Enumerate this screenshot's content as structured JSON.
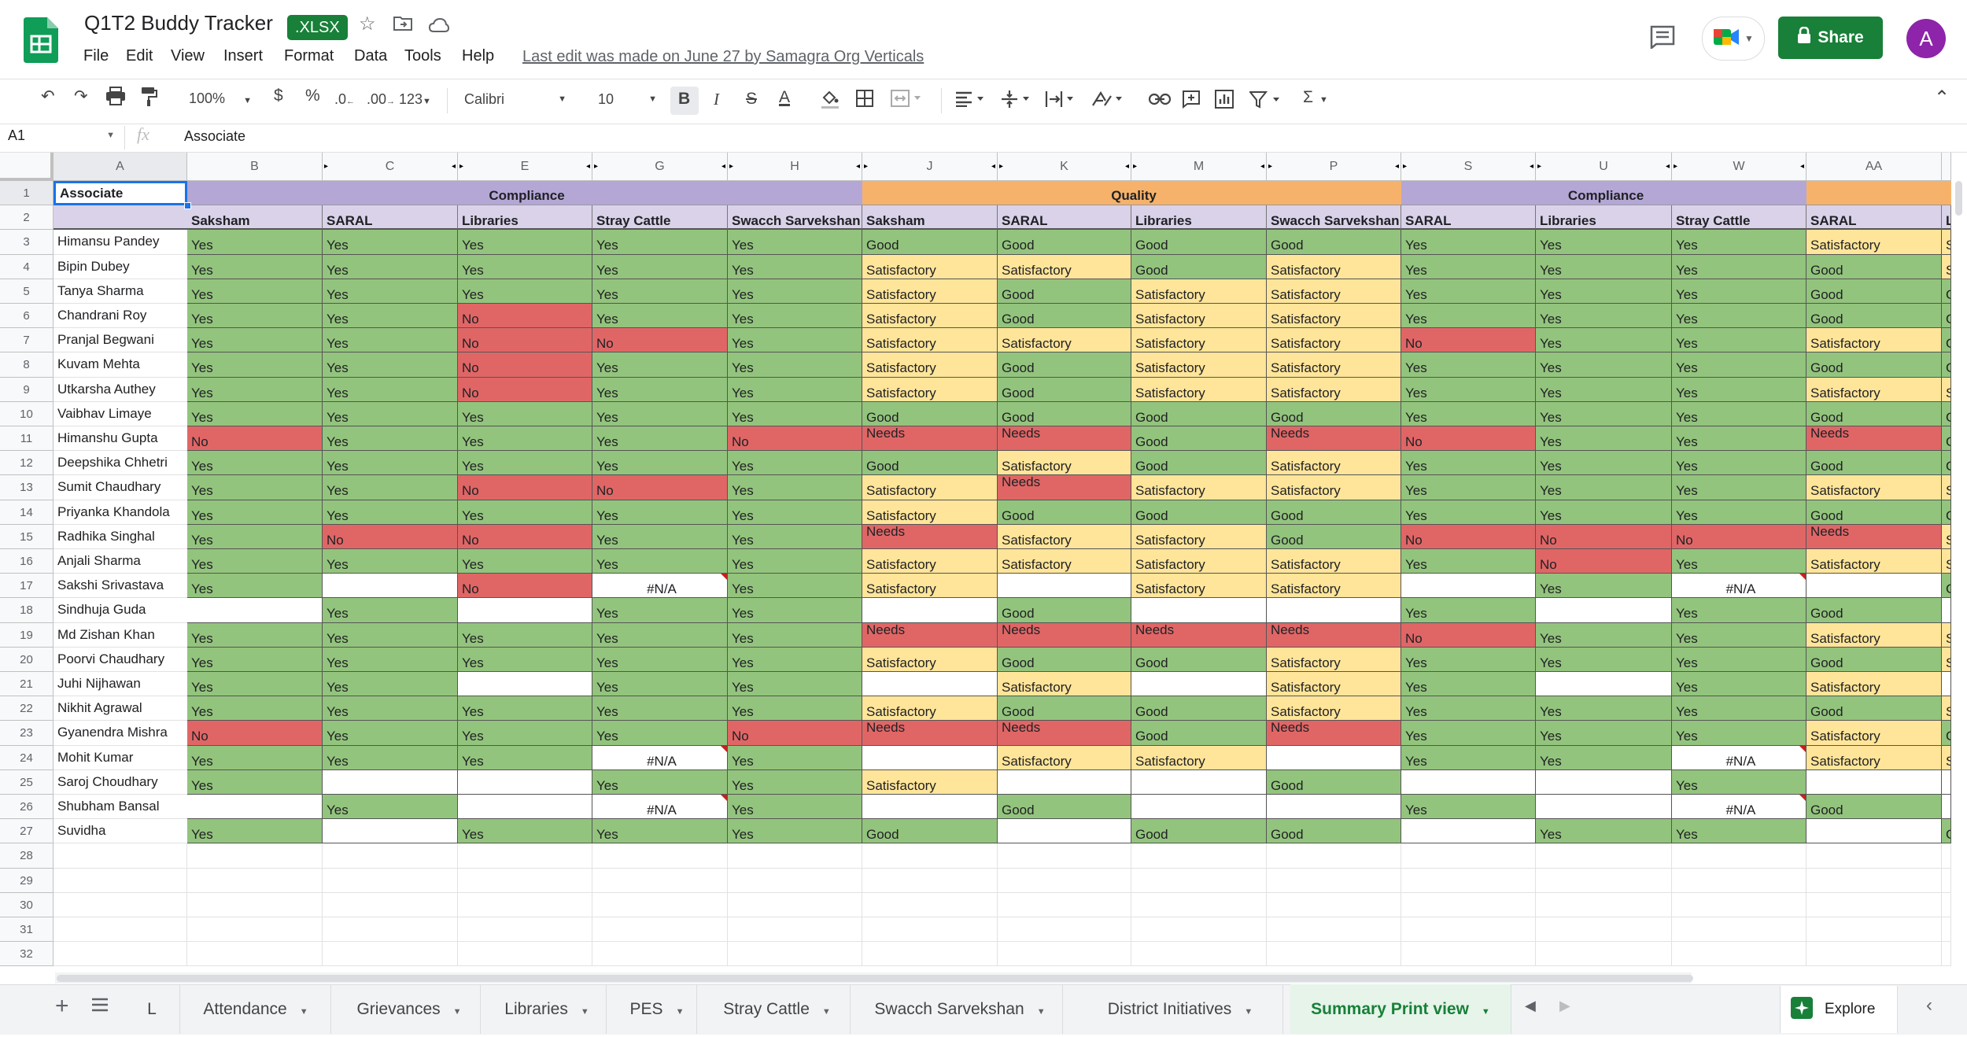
{
  "doc": {
    "title": "Q1T2 Buddy Tracker",
    "badge": ".XLSX",
    "last_edit": "Last edit was made on June 27 by Samagra Org Verticals"
  },
  "menu": [
    "File",
    "Edit",
    "View",
    "Insert",
    "Format",
    "Data",
    "Tools",
    "Help"
  ],
  "share_label": "Share",
  "avatar_letter": "A",
  "toolbar": {
    "zoom": "100%",
    "currency": "$",
    "percent": "%",
    "dec_less": ".0",
    "dec_more": ".00",
    "format": "123",
    "font": "Calibri",
    "size": "10",
    "bold": "B",
    "italic": "I",
    "strike": "S",
    "textcolor": "A"
  },
  "formula_bar": {
    "name_box": "A1",
    "fx": "fx",
    "value": "Associate"
  },
  "colors": {
    "green": "#93c47d",
    "yellow": "#ffe599",
    "red": "#e06666",
    "purple_header": "#b4a7d6",
    "subheader": "#d9d2e9",
    "orange_header": "#f6b26b",
    "share": "#188038"
  },
  "grid": {
    "col_headers": [
      "A",
      "B",
      "C",
      "E",
      "G",
      "H",
      "J",
      "K",
      "M",
      "P",
      "S",
      "U",
      "W",
      "AA",
      ""
    ],
    "row_numbers": [
      "1",
      "2",
      "3",
      "4",
      "5",
      "6",
      "7",
      "8",
      "9",
      "10",
      "11",
      "12",
      "13",
      "14",
      "15",
      "16",
      "17",
      "18",
      "19",
      "20",
      "21",
      "22",
      "23",
      "24",
      "25",
      "26",
      "27",
      "28",
      "29",
      "30",
      "31",
      "32"
    ],
    "group_headers": [
      {
        "label": "Compliance"
      },
      {
        "label": "Quality"
      },
      {
        "label": "Compliance"
      }
    ],
    "a1_label": "Associate",
    "sub_headers": [
      "Saksham",
      "SARAL",
      "Libraries",
      "Stray Cattle",
      "Swacch Sarvekshan",
      "Saksham",
      "SARAL",
      "Libraries",
      "Swacch Sarvekshan",
      "SARAL",
      "Libraries",
      "Stray Cattle",
      "SARAL",
      "Li"
    ],
    "associates": [
      "Himansu Pandey",
      "Bipin Dubey",
      "Tanya Sharma",
      "Chandrani Roy",
      "Pranjal Begwani",
      "Kuvam Mehta",
      "Utkarsha Authey",
      "Vaibhav Limaye",
      "Himanshu Gupta",
      "Deepshika Chhetri",
      "Sumit Chaudhary",
      "Priyanka Khandola",
      "Radhika Singhal",
      "Anjali Sharma",
      "Sakshi Srivastava",
      "Sindhuja Guda",
      "Md Zishan Khan",
      "Poorvi Chaudhary",
      "Juhi Nijhawan",
      "Nikhit Agrawal",
      "Gyanendra Mishra",
      "Mohit Kumar",
      "Saroj Choudhary",
      "Shubham Bansal",
      "Suvidha"
    ],
    "rows": [
      [
        "Yes",
        "Yes",
        "Yes",
        "Yes",
        "Yes",
        "Good",
        "Good",
        "Good",
        "Good",
        "Yes",
        "Yes",
        "Yes",
        "Satisfactory",
        "Sa"
      ],
      [
        "Yes",
        "Yes",
        "Yes",
        "Yes",
        "Yes",
        "Satisfactory",
        "Satisfactory",
        "Good",
        "Satisfactory",
        "Yes",
        "Yes",
        "Yes",
        "Good",
        "Sa"
      ],
      [
        "Yes",
        "Yes",
        "Yes",
        "Yes",
        "Yes",
        "Satisfactory",
        "Good",
        "Satisfactory",
        "Satisfactory",
        "Yes",
        "Yes",
        "Yes",
        "Good",
        "G"
      ],
      [
        "Yes",
        "Yes",
        "No",
        "Yes",
        "Yes",
        "Satisfactory",
        "Good",
        "Satisfactory",
        "Satisfactory",
        "Yes",
        "Yes",
        "Yes",
        "Good",
        "G"
      ],
      [
        "Yes",
        "Yes",
        "No",
        "No",
        "Yes",
        "Satisfactory",
        "Satisfactory",
        "Satisfactory",
        "Satisfactory",
        "No",
        "Yes",
        "Yes",
        "Satisfactory",
        "G"
      ],
      [
        "Yes",
        "Yes",
        "No",
        "Yes",
        "Yes",
        "Satisfactory",
        "Good",
        "Satisfactory",
        "Satisfactory",
        "Yes",
        "Yes",
        "Yes",
        "Good",
        "G"
      ],
      [
        "Yes",
        "Yes",
        "No",
        "Yes",
        "Yes",
        "Satisfactory",
        "Good",
        "Satisfactory",
        "Satisfactory",
        "Yes",
        "Yes",
        "Yes",
        "Satisfactory",
        "Sa"
      ],
      [
        "Yes",
        "Yes",
        "Yes",
        "Yes",
        "Yes",
        "Good",
        "Good",
        "Good",
        "Good",
        "Yes",
        "Yes",
        "Yes",
        "Good",
        "G"
      ],
      [
        "No",
        "Yes",
        "Yes",
        "Yes",
        "No",
        "Needs",
        "Needs",
        "Good",
        "Needs",
        "No",
        "Yes",
        "Yes",
        "Needs",
        "G"
      ],
      [
        "Yes",
        "Yes",
        "Yes",
        "Yes",
        "Yes",
        "Good",
        "Satisfactory",
        "Good",
        "Satisfactory",
        "Yes",
        "Yes",
        "Yes",
        "Good",
        "G"
      ],
      [
        "Yes",
        "Yes",
        "No",
        "No",
        "Yes",
        "Satisfactory",
        "Needs",
        "Satisfactory",
        "Satisfactory",
        "Yes",
        "Yes",
        "Yes",
        "Satisfactory",
        "Sa"
      ],
      [
        "Yes",
        "Yes",
        "Yes",
        "Yes",
        "Yes",
        "Satisfactory",
        "Good",
        "Good",
        "Good",
        "Yes",
        "Yes",
        "Yes",
        "Good",
        "G"
      ],
      [
        "Yes",
        "No",
        "No",
        "Yes",
        "Yes",
        "Needs",
        "Satisfactory",
        "Satisfactory",
        "Good",
        "No",
        "No",
        "No",
        "Needs",
        "Sa"
      ],
      [
        "Yes",
        "Yes",
        "Yes",
        "Yes",
        "Yes",
        "Satisfactory",
        "Satisfactory",
        "Satisfactory",
        "Satisfactory",
        "Yes",
        "No",
        "Yes",
        "Satisfactory",
        "Sa"
      ],
      [
        "Yes",
        "",
        "No",
        "#N/A",
        "Yes",
        "Satisfactory",
        "",
        "Satisfactory",
        "Satisfactory",
        "",
        "Yes",
        "#N/A",
        "",
        "G"
      ],
      [
        "",
        "Yes",
        "",
        "Yes",
        "Yes",
        "",
        "Good",
        "",
        "",
        "Yes",
        "",
        "Yes",
        "Good",
        ""
      ],
      [
        "Yes",
        "Yes",
        "Yes",
        "Yes",
        "Yes",
        "Needs",
        "Needs",
        "Needs",
        "Needs",
        "No",
        "Yes",
        "Yes",
        "Satisfactory",
        "Sa"
      ],
      [
        "Yes",
        "Yes",
        "Yes",
        "Yes",
        "Yes",
        "Satisfactory",
        "Good",
        "Good",
        "Satisfactory",
        "Yes",
        "Yes",
        "Yes",
        "Good",
        "Sa"
      ],
      [
        "Yes",
        "Yes",
        "",
        "Yes",
        "Yes",
        "",
        "Satisfactory",
        "",
        "Satisfactory",
        "Yes",
        "",
        "Yes",
        "Satisfactory",
        ""
      ],
      [
        "Yes",
        "Yes",
        "Yes",
        "Yes",
        "Yes",
        "Satisfactory",
        "Good",
        "Good",
        "Satisfactory",
        "Yes",
        "Yes",
        "Yes",
        "Good",
        "Sa"
      ],
      [
        "No",
        "Yes",
        "Yes",
        "Yes",
        "No",
        "Needs",
        "Needs",
        "Good",
        "Needs",
        "Yes",
        "Yes",
        "Yes",
        "Satisfactory",
        "G"
      ],
      [
        "Yes",
        "Yes",
        "Yes",
        "#N/A",
        "Yes",
        "",
        "Satisfactory",
        "Satisfactory",
        "",
        "Yes",
        "Yes",
        "#N/A",
        "Satisfactory",
        "Sa"
      ],
      [
        "Yes",
        "",
        "",
        "Yes",
        "Yes",
        "Satisfactory",
        "",
        "",
        "Good",
        "",
        "",
        "Yes",
        "",
        ""
      ],
      [
        "",
        "Yes",
        "",
        "#N/A",
        "Yes",
        "",
        "Good",
        "",
        "",
        "Yes",
        "",
        "#N/A",
        "Good",
        ""
      ],
      [
        "Yes",
        "",
        "Yes",
        "Yes",
        "Yes",
        "Good",
        "",
        "Good",
        "Good",
        "",
        "Yes",
        "Yes",
        "",
        "G"
      ]
    ]
  },
  "sheet_tabs": [
    "L",
    "Attendance",
    "Grievances",
    "Libraries",
    "PES",
    "Stray Cattle",
    "Swacch Sarvekshan",
    "District Initiatives",
    "Summary Print view"
  ],
  "explore_label": "Explore"
}
